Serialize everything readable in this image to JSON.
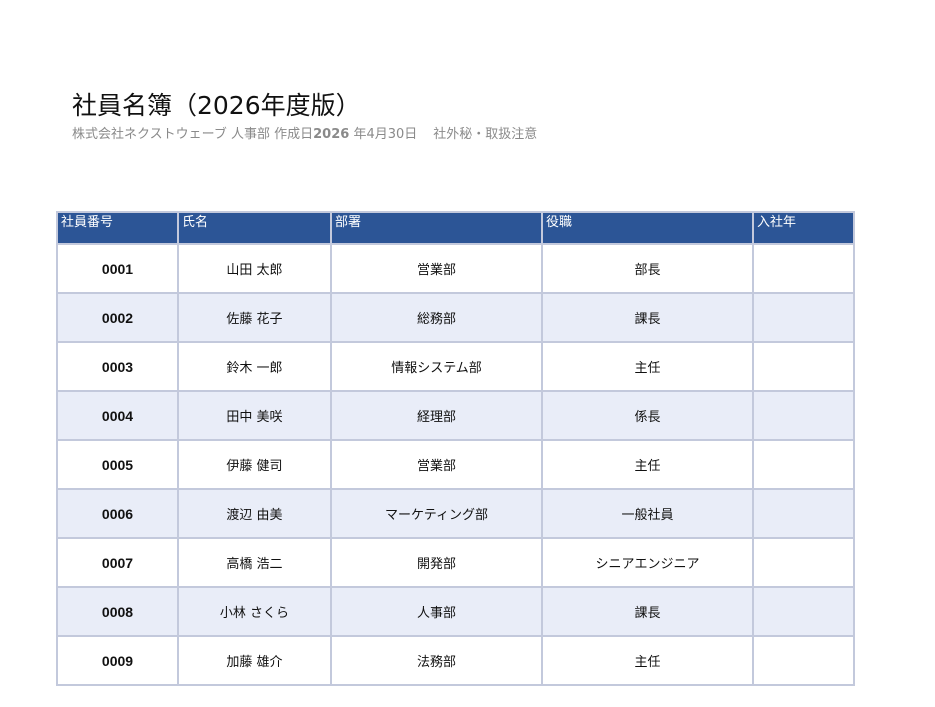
{
  "document": {
    "title": "社員名簿（2026年度版）",
    "subtitle": {
      "company_dept": "株式会社ネクストウェーブ 人事部",
      "created_label": "作成日",
      "created_year": "2026",
      "created_rest": "年4月30日",
      "confidential": "社外秘・取扱注意"
    }
  },
  "table": {
    "headers": [
      "社員番号",
      "氏名",
      "部署",
      "役職",
      "入社年"
    ],
    "rows": [
      {
        "id": "0001",
        "name": "山田 太郎",
        "dept": "営業部",
        "role": "部長",
        "year": ""
      },
      {
        "id": "0002",
        "name": "佐藤 花子",
        "dept": "総務部",
        "role": "課長",
        "year": ""
      },
      {
        "id": "0003",
        "name": "鈴木 一郎",
        "dept": "情報システム部",
        "role": "主任",
        "year": ""
      },
      {
        "id": "0004",
        "name": "田中 美咲",
        "dept": "経理部",
        "role": "係長",
        "year": ""
      },
      {
        "id": "0005",
        "name": "伊藤 健司",
        "dept": "営業部",
        "role": "主任",
        "year": ""
      },
      {
        "id": "0006",
        "name": "渡辺 由美",
        "dept": "マーケティング部",
        "role": "一般社員",
        "year": ""
      },
      {
        "id": "0007",
        "name": "高橋 浩二",
        "dept": "開発部",
        "role": "シニアエンジニア",
        "year": ""
      },
      {
        "id": "0008",
        "name": "小林 さくら",
        "dept": "人事部",
        "role": "課長",
        "year": ""
      },
      {
        "id": "0009",
        "name": "加藤 雄介",
        "dept": "法務部",
        "role": "主任",
        "year": ""
      }
    ]
  },
  "colors": {
    "header_bg": "#2c5596",
    "header_text": "#ffffff",
    "row_alt_bg": "#e9edf8",
    "grid": "#c3c9dc",
    "subtitle_text": "#8a8a8a"
  }
}
